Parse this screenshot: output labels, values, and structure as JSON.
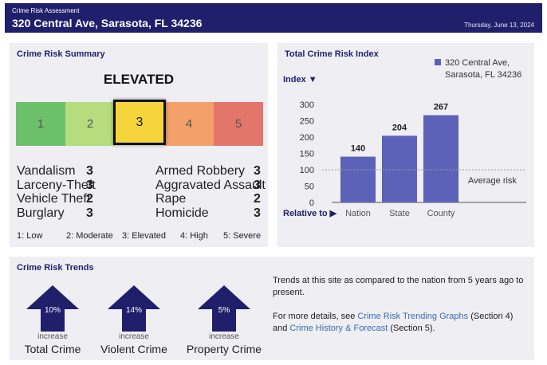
{
  "header": {
    "subtitle": "Crime Risk Assessment",
    "address": "320 Central Ave, Sarasota, FL 34236",
    "date": "Thursday, June 13, 2024"
  },
  "summary": {
    "title": "Crime Risk Summary",
    "level": "ELEVATED",
    "scale": [
      {
        "label": "1",
        "color": "#6cc06a"
      },
      {
        "label": "2",
        "color": "#b5dc7f"
      },
      {
        "label": "3",
        "color": "#f5d53b"
      },
      {
        "label": "4",
        "color": "#f3a06b"
      },
      {
        "label": "5",
        "color": "#e4756a"
      }
    ],
    "active_level": 3,
    "crimes_left": [
      {
        "name": "Vandalism",
        "value": "3"
      },
      {
        "name": "Larceny-Theft",
        "value": "3"
      },
      {
        "name": "Vehicle Theft",
        "value": "2"
      },
      {
        "name": "Burglary",
        "value": "3"
      }
    ],
    "crimes_right": [
      {
        "name": "Armed Robbery",
        "value": "3"
      },
      {
        "name": "Aggravated Assault",
        "value": "3"
      },
      {
        "name": "Rape",
        "value": "2"
      },
      {
        "name": "Homicide",
        "value": "3"
      }
    ],
    "legend": [
      "1: Low",
      "2: Moderate",
      "3: Elevated",
      "4: High",
      "5: Severe"
    ]
  },
  "index": {
    "title": "Total Crime Risk Index",
    "y_axis_label": "Index ▼",
    "x_axis_label": "Relative to ▶",
    "legend_label_line1": "320 Central Ave,",
    "legend_label_line2": "Sarasota, FL 34236",
    "average_label": "Average risk"
  },
  "chart_data": {
    "type": "bar",
    "title": "Total Crime Risk Index",
    "categories": [
      "Nation",
      "State",
      "County"
    ],
    "values": [
      140,
      204,
      267
    ],
    "ylim": [
      0,
      300
    ],
    "yticks": [
      0,
      50,
      100,
      150,
      200,
      250,
      300
    ],
    "reference_line": 100,
    "bar_color": "#5b62b8",
    "grid": false
  },
  "trends": {
    "title": "Crime Risk Trends",
    "items": [
      {
        "pct": "10%",
        "direction": "increase",
        "name": "Total Crime"
      },
      {
        "pct": "14%",
        "direction": "increase",
        "name": "Violent Crime"
      },
      {
        "pct": "5%",
        "direction": "increase",
        "name": "Property Crime"
      }
    ],
    "arrow_color": "#1f1f6b",
    "text1": "Trends at this site as compared to the nation from 5 years ago to present.",
    "text2_prefix": "For more details, see ",
    "link1": "Crime Risk Trending Graphs",
    "text2_mid1": " (Section 4) and ",
    "link2": "Crime History & Forecast",
    "text2_suffix": " (Section 5)."
  }
}
